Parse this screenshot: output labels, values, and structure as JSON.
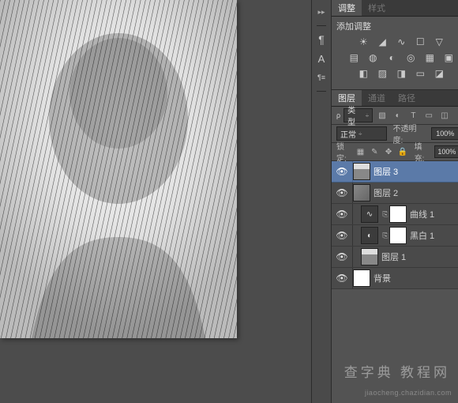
{
  "adjustments_panel": {
    "tab_active": "调整",
    "tab_secondary": "样式",
    "title": "添加调整"
  },
  "layers_panel": {
    "tab_active": "图层",
    "tab_channels": "通道",
    "tab_paths": "路径",
    "kind_label": "类型",
    "blend_mode": "正常",
    "opacity_label": "不透明度:",
    "opacity_value": "100%",
    "lock_label": "锁定:",
    "fill_label": "填充:",
    "fill_value": "100%"
  },
  "layers": [
    {
      "name": "图层 3",
      "visible": true,
      "selected": true,
      "thumb": "img",
      "mask": false,
      "indent": 0
    },
    {
      "name": "图层 2",
      "visible": true,
      "selected": false,
      "thumb": "gray",
      "mask": false,
      "indent": 0
    },
    {
      "name": "曲线 1",
      "visible": true,
      "selected": false,
      "thumb": "adj",
      "adj_glyph": "∿",
      "mask": true,
      "indent": 1
    },
    {
      "name": "黑白 1",
      "visible": true,
      "selected": false,
      "thumb": "adj",
      "adj_glyph": "◐",
      "mask": true,
      "indent": 1
    },
    {
      "name": "图层 1",
      "visible": true,
      "selected": false,
      "thumb": "img",
      "mask": false,
      "indent": 1
    },
    {
      "name": "背景",
      "visible": true,
      "selected": false,
      "thumb": "white",
      "mask": false,
      "indent": 0
    }
  ],
  "watermark": "查字典 教程网",
  "footer_url": "jiaocheng.chazidian.com"
}
